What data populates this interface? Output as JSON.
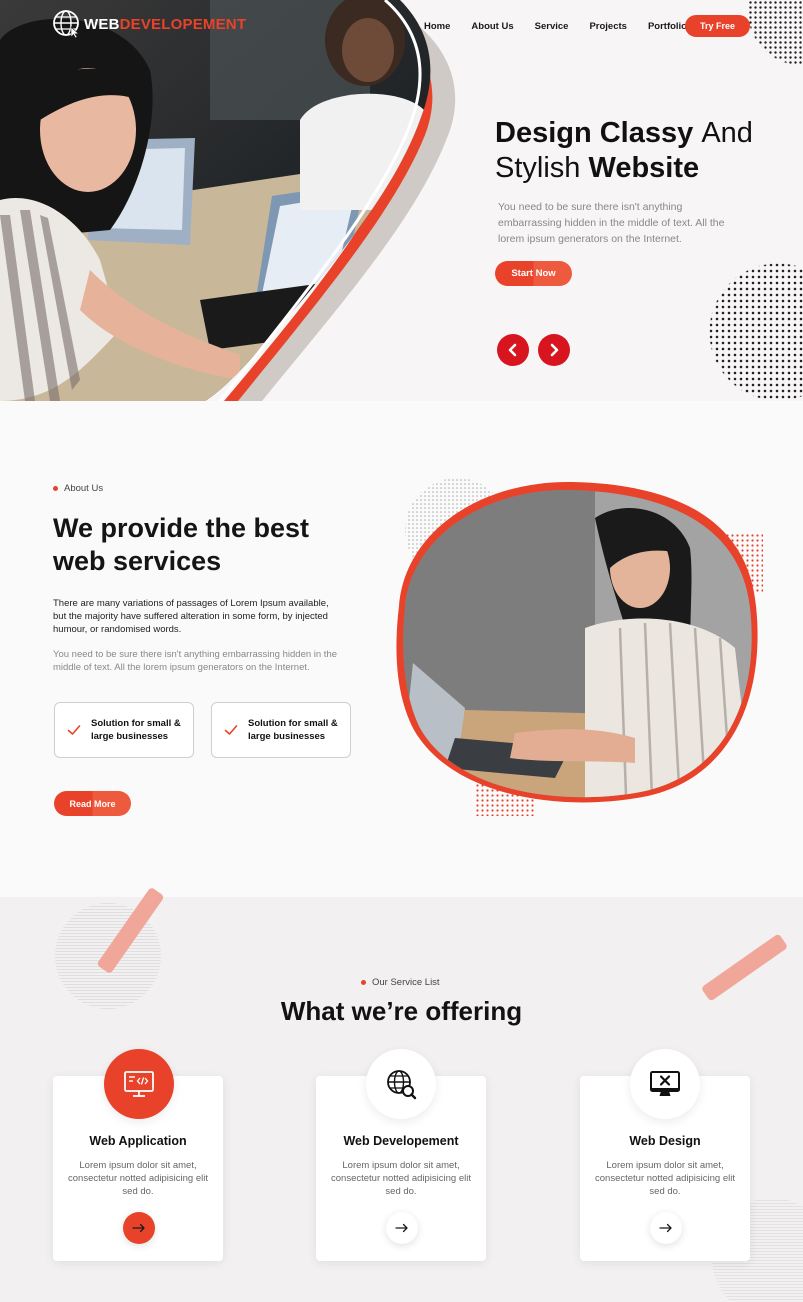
{
  "brand": {
    "logo_web": "WEB",
    "logo_dev": "DEVELOPEMENT",
    "accent": "#e8432a",
    "arrow_red": "#d8141f"
  },
  "nav": {
    "items": [
      "Home",
      "About Us",
      "Service",
      "Projects",
      "Portfolio"
    ],
    "cta": "Try Free"
  },
  "hero": {
    "title_bold_1": "Design Classy",
    "title_light_1": "And",
    "title_light_2": "Stylish",
    "title_bold_2": "Website",
    "description": "You need to be sure there isn't anything embarrassing hidden in the middle of text. All the lorem ipsum generators on the Internet.",
    "cta": "Start  Now",
    "prev_icon": "chevron-left-icon",
    "next_icon": "chevron-right-icon"
  },
  "about": {
    "eyebrow": "About Us",
    "title_line1": "We provide the best",
    "title_line2": "web services",
    "paragraph_bold": "There are many variations of passages of Lorem Ipsum available, but the majority have suffered alteration in some form, by injected humour, or randomised words.",
    "paragraph_light": "You need to be sure there isn't anything embarrassing hidden in the middle of text. All the lorem ipsum generators on the Internet.",
    "features": [
      {
        "line1": "Solution for small &",
        "line2": "large businesses"
      },
      {
        "line1": "Solution for small &",
        "line2": "large businesses"
      }
    ],
    "cta": "Read More"
  },
  "services": {
    "eyebrow": "Our Service List",
    "title": "What we’re offering",
    "cards": [
      {
        "title": "Web Application",
        "desc": "Lorem ipsum dolor sit amet, consectetur notted adipisicing elit sed do.",
        "icon": "code-monitor-icon"
      },
      {
        "title": "Web Developement",
        "desc": "Lorem ipsum dolor sit amet, consectetur notted adipisicing elit sed do.",
        "icon": "globe-search-icon"
      },
      {
        "title": "Web Design",
        "desc": "Lorem ipsum dolor sit amet, consectetur notted adipisicing elit sed do.",
        "icon": "monitor-x-icon"
      }
    ]
  }
}
